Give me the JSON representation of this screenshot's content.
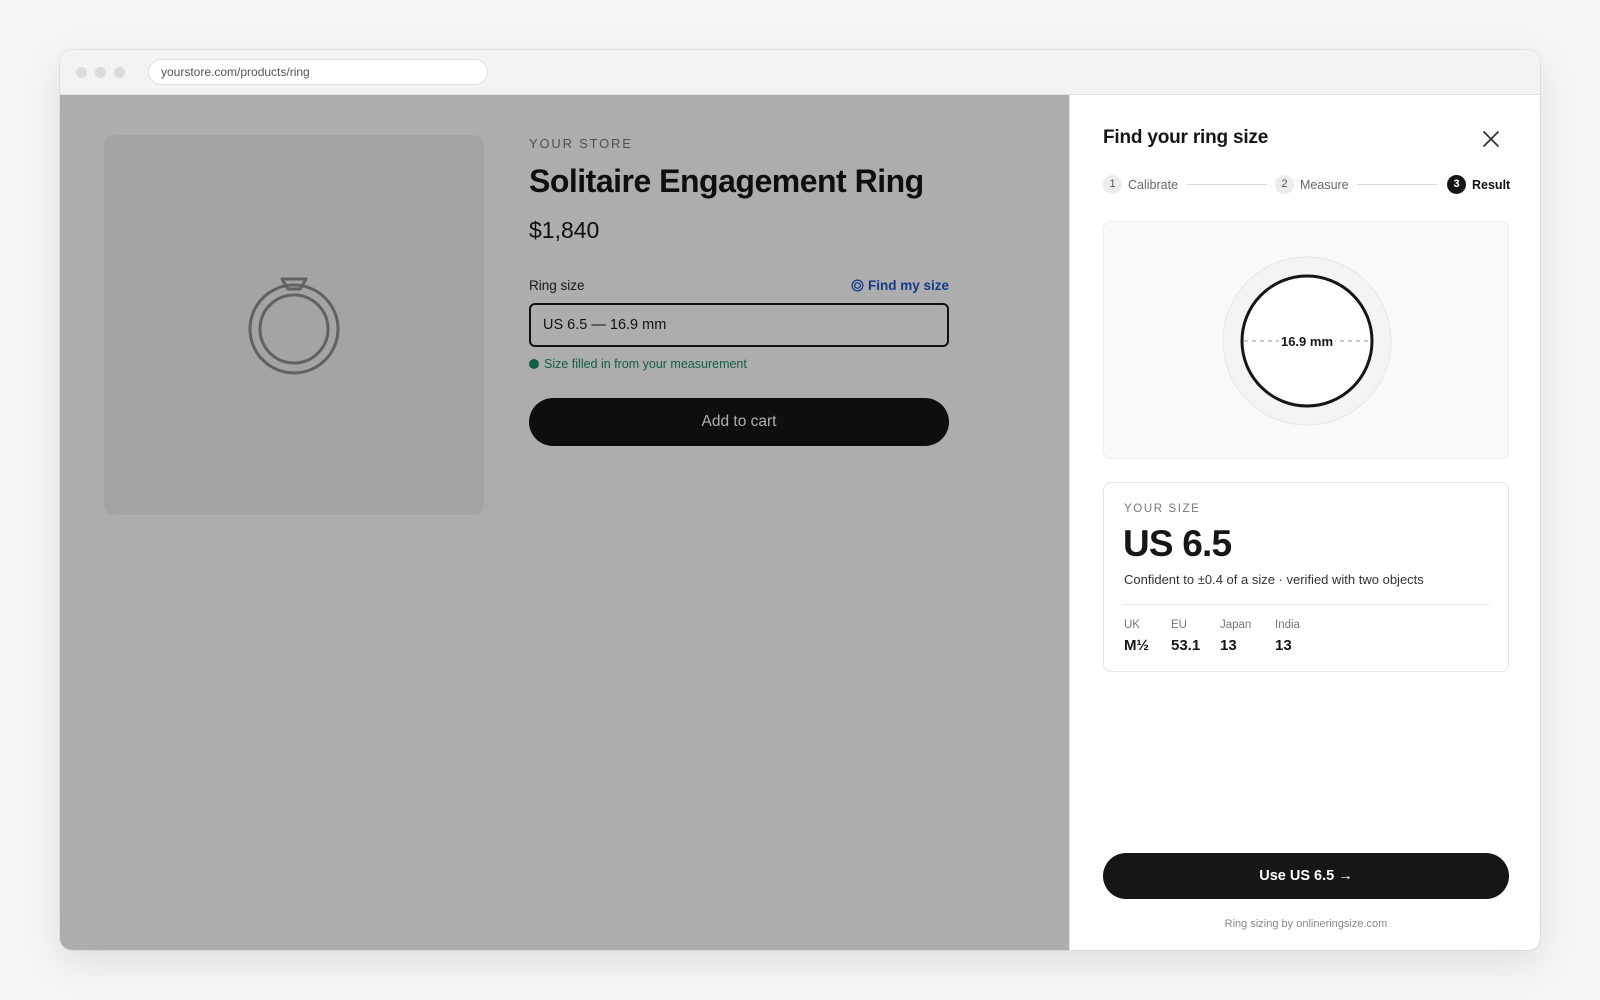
{
  "browser": {
    "url": "yourstore.com/products/ring"
  },
  "product": {
    "store": "YOUR STORE",
    "title": "Solitaire Engagement Ring",
    "price": "$1,840",
    "ring_size_label": "Ring size",
    "find_size_link": "Find my size",
    "size_field_value": "US 6.5 — 16.9 mm",
    "filled_note": "Size filled in from your measurement",
    "add_to_cart": "Add to cart"
  },
  "sizer": {
    "title": "Find your ring size",
    "steps": [
      {
        "number": "1",
        "label": "Calibrate",
        "state": "done"
      },
      {
        "number": "2",
        "label": "Measure",
        "state": "done"
      },
      {
        "number": "3",
        "label": "Result",
        "state": "active"
      }
    ],
    "diameter_label": "16.9 mm",
    "your_size_label": "YOUR SIZE",
    "your_size_value": "US 6.5",
    "confidence": "Confident to ±0.4 of a size · verified with two objects",
    "conversions": [
      {
        "label": "UK",
        "value": "M½"
      },
      {
        "label": "EU",
        "value": "53.1"
      },
      {
        "label": "Japan",
        "value": "13"
      },
      {
        "label": "India",
        "value": "13"
      }
    ],
    "use_button": "Use US 6.5 →",
    "powered_by": "Ring sizing by onlineringsize.com"
  },
  "colors": {
    "accent_link": "#1e56c8",
    "success": "#1f8a63",
    "primary_button": "#161616"
  }
}
